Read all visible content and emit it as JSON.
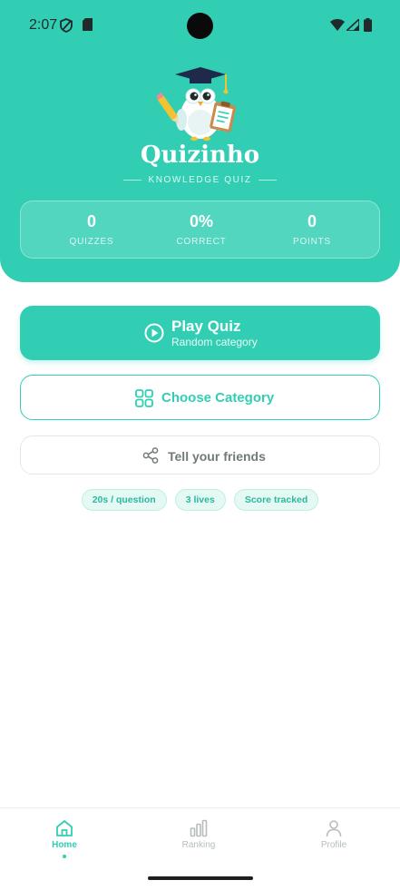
{
  "status_bar": {
    "time": "2:07"
  },
  "header": {
    "app_title": "Quizinho",
    "subtitle": "KNOWLEDGE QUIZ",
    "stats": [
      {
        "value": "0",
        "label": "QUIZZES"
      },
      {
        "value": "0%",
        "label": "CORRECT"
      },
      {
        "value": "0",
        "label": "POINTS"
      }
    ]
  },
  "actions": {
    "play": {
      "title": "Play Quiz",
      "subtitle": "Random category",
      "icon": "play-circle-icon"
    },
    "category": {
      "label": "Choose Category",
      "icon": "grid-icon"
    },
    "share": {
      "label": "Tell your friends",
      "icon": "share-icon"
    }
  },
  "chips": [
    "20s / question",
    "3 lives",
    "Score tracked"
  ],
  "bottom_nav": [
    {
      "label": "Home",
      "icon": "home-icon",
      "active": true
    },
    {
      "label": "Ranking",
      "icon": "bar-chart-icon",
      "active": false
    },
    {
      "label": "Profile",
      "icon": "user-icon",
      "active": false
    }
  ],
  "colors": {
    "accent": "#31CEB4",
    "muted": "#b5bdbc"
  }
}
